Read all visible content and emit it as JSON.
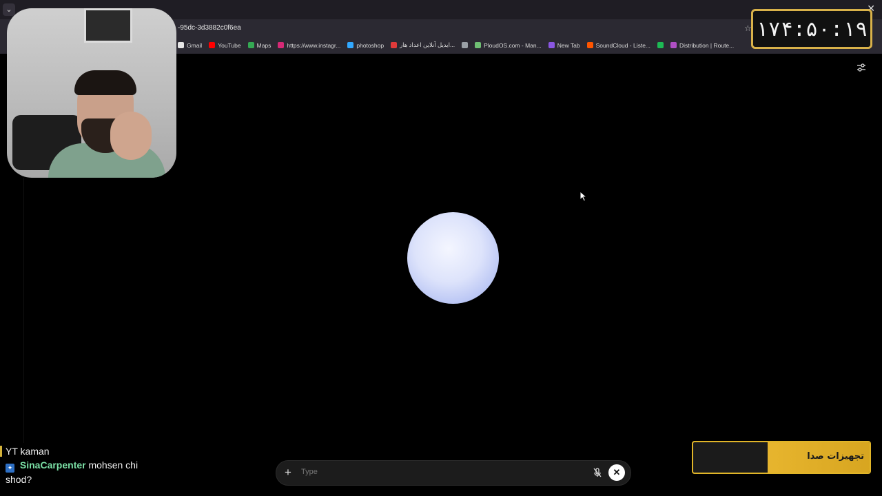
{
  "browser": {
    "url_fragment": "-95dc-3d3882c0f6ea",
    "tab_menu_icon": "chevron-down-icon",
    "close_glyph": "✕",
    "star_icon": "star-icon",
    "bookmarks": [
      {
        "label": "Gmail",
        "color": "#e5e5e5"
      },
      {
        "label": "YouTube",
        "color": "#ff0000"
      },
      {
        "label": "Maps",
        "color": "#34a853"
      },
      {
        "label": "https://www.instagr...",
        "color": "#d62976"
      },
      {
        "label": "photoshop",
        "color": "#31a8ff"
      },
      {
        "label": "ایدیل آنلاین اعداد هار...",
        "color": "#e03a3a"
      },
      {
        "label": "",
        "color": "#9aa0a6"
      },
      {
        "label": "PloudOS.com - Man...",
        "color": "#6fbf73"
      },
      {
        "label": "New Tab",
        "color": "#8a56e2"
      },
      {
        "label": "SoundCloud - Liste...",
        "color": "#ff5500"
      },
      {
        "label": "",
        "color": "#1db954"
      },
      {
        "label": "Distribution | Route...",
        "color": "#b04fc4"
      }
    ]
  },
  "voice_mode": {
    "settings_icon": "sliders-icon",
    "orb_color": "#dde3fb"
  },
  "composer": {
    "plus_glyph": "+",
    "placeholder": "Type",
    "mic_icon": "mic-off-icon",
    "close_glyph": "✕"
  },
  "overlay": {
    "timer": "۱۷۴:۵۰:۱۹",
    "banner_label": "تجهیزات صدا",
    "chat": [
      {
        "user": "",
        "message": "YT kaman"
      },
      {
        "user": "SinaCarpenter",
        "message": " mohsen chi shod?"
      }
    ]
  }
}
